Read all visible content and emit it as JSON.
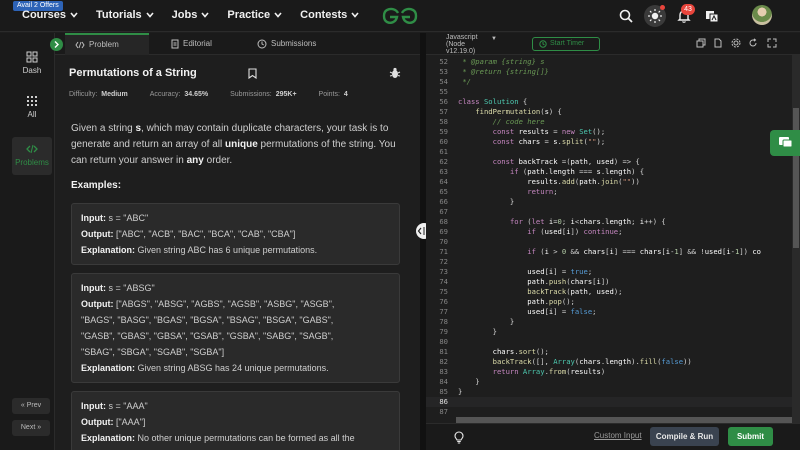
{
  "topnav": {
    "offer_badge": "Avail 2 Offers",
    "menu": [
      "Courses",
      "Tutorials",
      "Jobs",
      "Practice",
      "Contests"
    ],
    "notification_count": "43",
    "icons": [
      "search-icon",
      "theme-toggle-icon",
      "bell-icon",
      "translate-icon",
      "avatar"
    ]
  },
  "sidenav": {
    "items": [
      {
        "label": "Dash",
        "icon": "dashboard-icon"
      },
      {
        "label": "All",
        "icon": "grid-icon"
      },
      {
        "label": "Problems",
        "icon": "code-icon"
      }
    ],
    "prev_label": "« Prev",
    "next_label": "Next »"
  },
  "problem_tabs": [
    "Problem",
    "Editorial",
    "Submissions"
  ],
  "problem": {
    "title": "Permutations of a String",
    "difficulty_label": "Difficulty:",
    "difficulty": "Medium",
    "accuracy_label": "Accuracy:",
    "accuracy": "34.65%",
    "submissions_label": "Submissions:",
    "submissions": "295K+",
    "points_label": "Points:",
    "points": "4",
    "desc_1": "Given a string ",
    "desc_s": "s",
    "desc_2": ", which may contain duplicate characters, your task is to generate and return an array of all ",
    "desc_unique": "unique",
    "desc_3": " permutations of the string. You can return your answer in ",
    "desc_any": "any",
    "desc_4": " order.",
    "examples_heading": "Examples:",
    "input_label": "Input:",
    "output_label": "Output:",
    "explanation_label": "Explanation:",
    "examples": [
      {
        "input": " s = \"ABC\"",
        "output": " [\"ABC\", \"ACB\", \"BAC\", \"BCA\", \"CAB\", \"CBA\"]",
        "explanation": " Given string ABC has 6 unique permutations."
      },
      {
        "input": " s = \"ABSG\"",
        "output_lines": [
          " [\"ABGS\", \"ABSG\", \"AGBS\", \"AGSB\", \"ASBG\", \"ASGB\",",
          "\"BAGS\", \"BASG\", \"BGAS\", \"BGSA\", \"BSAG\", \"BSGA\", \"GABS\",",
          "\"GASB\", \"GBAS\", \"GBSA\", \"GSAB\", \"GSBA\", \"SABG\", \"SAGB\",",
          "\"SBAG\", \"SBGA\", \"SGAB\", \"SGBA\"]"
        ],
        "explanation": " Given string ABSG has 24 unique permutations."
      },
      {
        "input": " s = \"AAA\"",
        "output": " [\"AAA\"]",
        "explanation": " No other unique permutations can be formed as all the"
      }
    ]
  },
  "editor": {
    "language": "Javascript",
    "language_version_1": "(Node",
    "language_version_2": "v12.19.0)",
    "timer_label": "Start Timer",
    "custom_input": "Custom Input",
    "compile_run": "Compile & Run",
    "submit": "Submit",
    "lines": [
      {
        "n": "52",
        "code": " * @param {string} s"
      },
      {
        "n": "53",
        "code": " * @return {string[]}"
      },
      {
        "n": "54",
        "code": " */"
      },
      {
        "n": "55",
        "code": ""
      },
      {
        "n": "56",
        "code": "class Solution {"
      },
      {
        "n": "57",
        "code": "    findPermutation(s) {"
      },
      {
        "n": "58",
        "code": "        // code here"
      },
      {
        "n": "59",
        "code": "        const results = new Set();"
      },
      {
        "n": "60",
        "code": "        const chars = s.split(\"\");"
      },
      {
        "n": "61",
        "code": ""
      },
      {
        "n": "62",
        "code": "        const backTrack =(path, used) => {"
      },
      {
        "n": "63",
        "code": "            if (path.length === s.length) {"
      },
      {
        "n": "64",
        "code": "                results.add(path.join(\"\"))"
      },
      {
        "n": "65",
        "code": "                return;"
      },
      {
        "n": "66",
        "code": "            }"
      },
      {
        "n": "67",
        "code": ""
      },
      {
        "n": "68",
        "code": "            for (let i=0; i<chars.length; i++) {"
      },
      {
        "n": "69",
        "code": "                if (used[i]) continue;"
      },
      {
        "n": "70",
        "code": ""
      },
      {
        "n": "71",
        "code": "                if (i > 0 && chars[i] === chars[i-1] && !used[i-1]) co"
      },
      {
        "n": "72",
        "code": ""
      },
      {
        "n": "73",
        "code": "                used[i] = true;"
      },
      {
        "n": "74",
        "code": "                path.push(chars[i])"
      },
      {
        "n": "75",
        "code": "                backTrack(path, used);"
      },
      {
        "n": "76",
        "code": "                path.pop();"
      },
      {
        "n": "77",
        "code": "                used[i] = false;"
      },
      {
        "n": "78",
        "code": "            }"
      },
      {
        "n": "79",
        "code": "        }"
      },
      {
        "n": "80",
        "code": ""
      },
      {
        "n": "81",
        "code": "        chars.sort();"
      },
      {
        "n": "82",
        "code": "        backTrack([], Array(chars.length).fill(false))"
      },
      {
        "n": "83",
        "code": "        return Array.from(results)"
      },
      {
        "n": "84",
        "code": "    }"
      },
      {
        "n": "85",
        "code": "}"
      },
      {
        "n": "86",
        "code": ""
      },
      {
        "n": "87",
        "code": ""
      }
    ]
  },
  "colors": {
    "accent_green": "#2f8d46",
    "background": "#1e1e1e",
    "notification_red": "#e8453c"
  }
}
